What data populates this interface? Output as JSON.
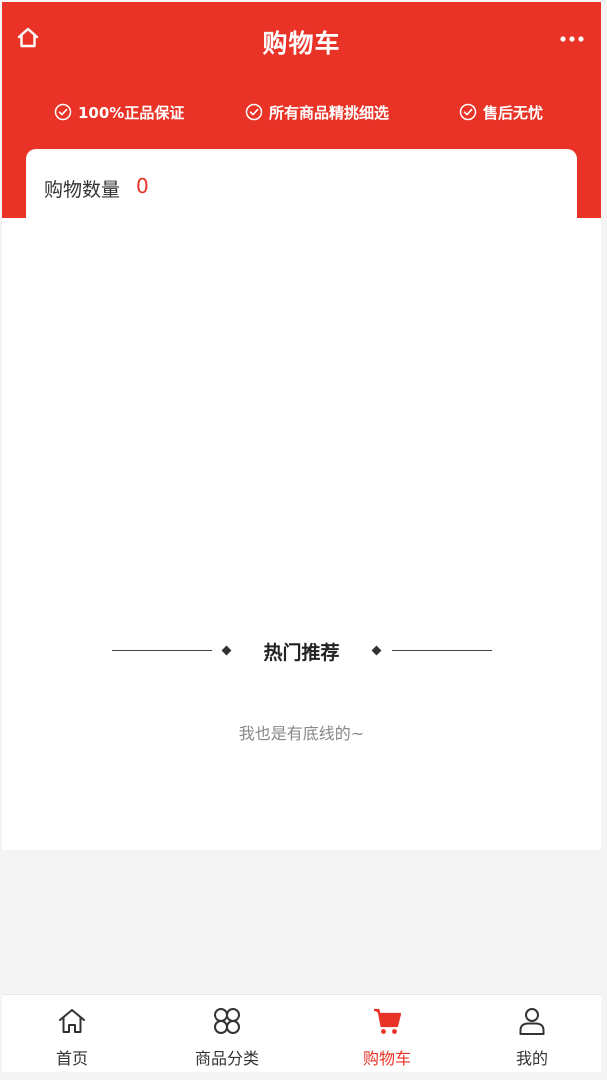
{
  "header": {
    "title": "购物车",
    "features": [
      {
        "label": "100%正品保证"
      },
      {
        "label": "所有商品精挑细选"
      },
      {
        "label": "售后无忧"
      }
    ]
  },
  "cart": {
    "count_label": "购物数量",
    "count_value": "0"
  },
  "recommend": {
    "title": "热门推荐",
    "bottom_note": "我也是有底线的~"
  },
  "tabbar": {
    "items": [
      {
        "label": "首页",
        "icon": "home-icon"
      },
      {
        "label": "商品分类",
        "icon": "category-icon"
      },
      {
        "label": "购物车",
        "icon": "cart-icon",
        "active": true
      },
      {
        "label": "我的",
        "icon": "user-icon"
      }
    ]
  },
  "colors": {
    "brand": "#e83326",
    "text": "#333333",
    "muted": "#888888"
  }
}
